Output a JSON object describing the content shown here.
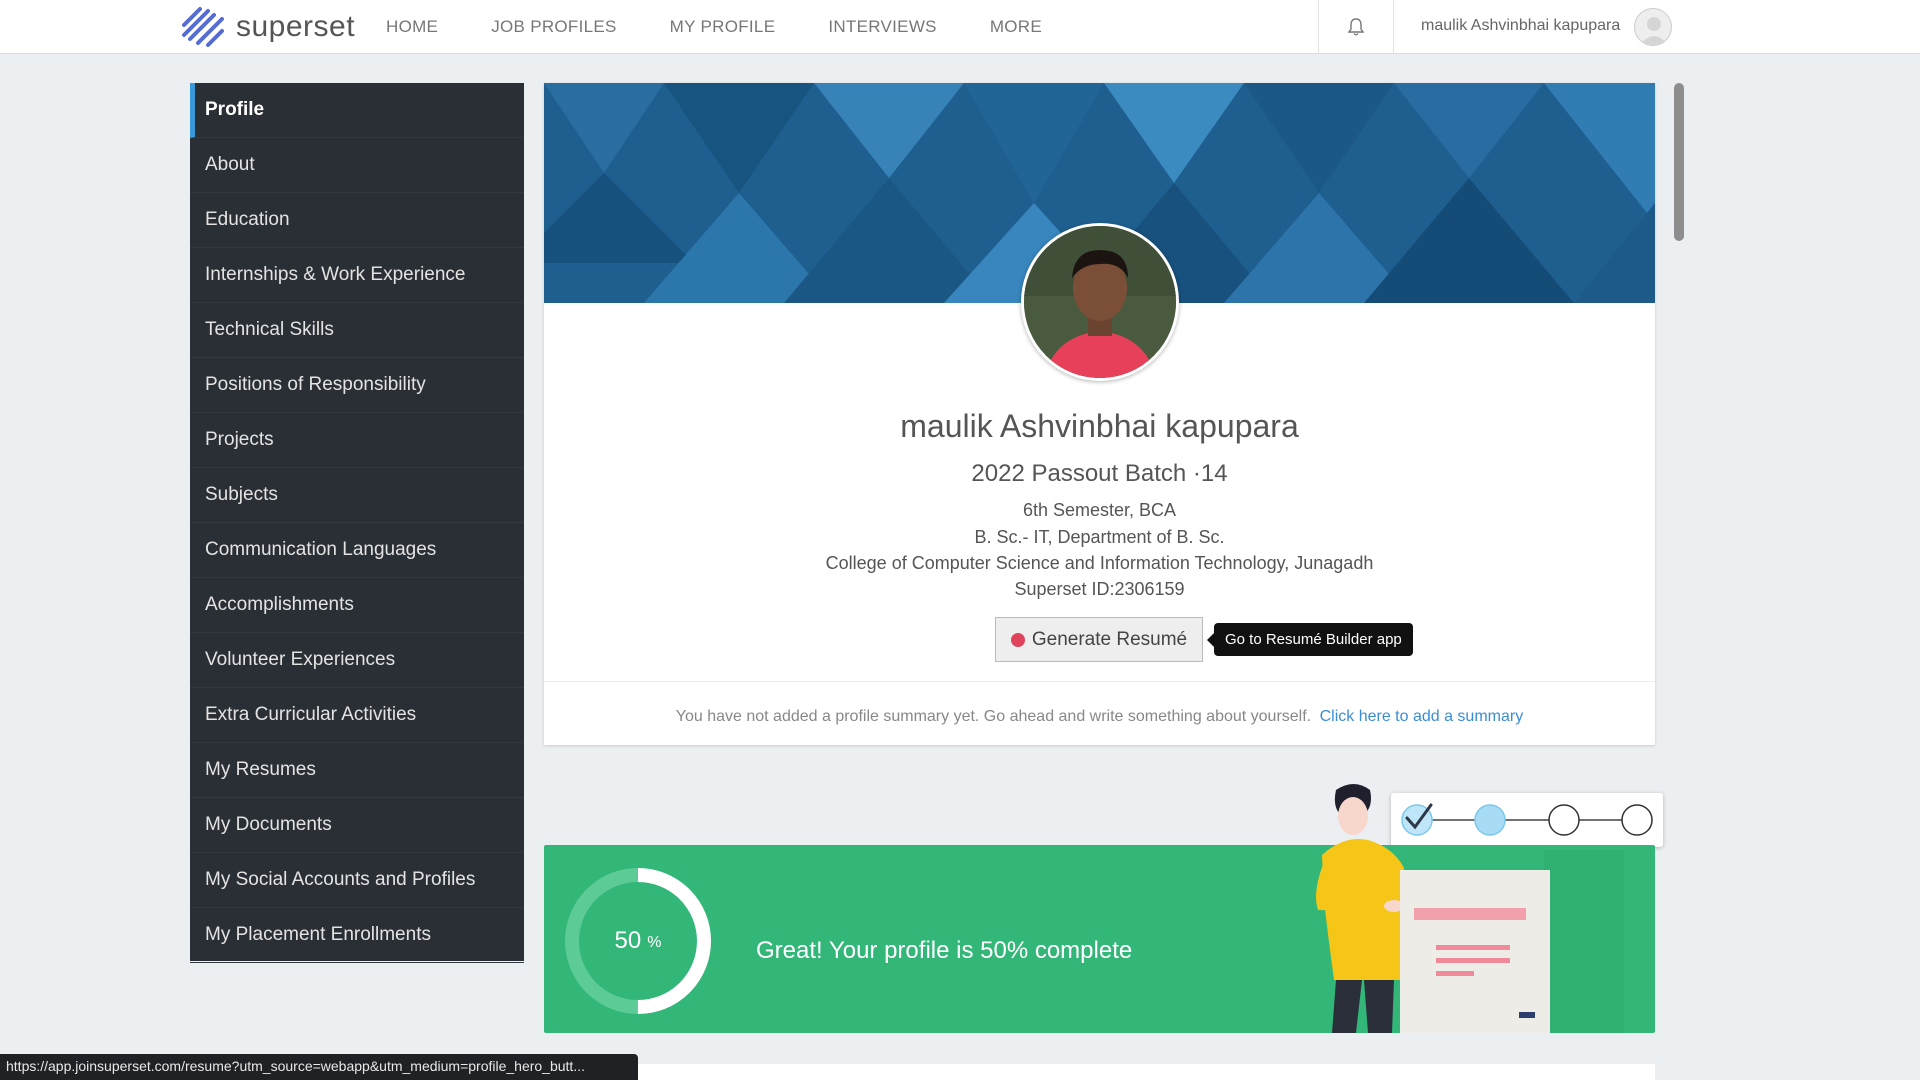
{
  "header": {
    "logo_text": "superset",
    "nav": [
      "HOME",
      "JOB PROFILES",
      "MY PROFILE",
      "INTERVIEWS",
      "MORE"
    ],
    "user_name": "maulik Ashvinbhai kapupara"
  },
  "sidebar": {
    "items": [
      {
        "label": "Profile"
      },
      {
        "label": "About"
      },
      {
        "label": "Education"
      },
      {
        "label": "Internships & Work Experience"
      },
      {
        "label": "Technical Skills"
      },
      {
        "label": "Positions of Responsibility"
      },
      {
        "label": "Projects"
      },
      {
        "label": "Subjects"
      },
      {
        "label": "Communication Languages"
      },
      {
        "label": "Accomplishments"
      },
      {
        "label": "Volunteer Experiences"
      },
      {
        "label": "Extra Curricular Activities"
      },
      {
        "label": "My Resumes"
      },
      {
        "label": "My Documents"
      },
      {
        "label": "My Social Accounts and Profiles"
      },
      {
        "label": "My Placement Enrollments"
      }
    ]
  },
  "profile": {
    "name": "maulik Ashvinbhai kapupara",
    "batch": "2022 Passout Batch ·14",
    "semester": "6th Semester, BCA",
    "department": "B. Sc.- IT, Department of B. Sc.",
    "college": "College of Computer Science and Information Technology, Junagadh",
    "superset_id": "Superset ID:2306159",
    "generate_button": "Generate Resumé",
    "tooltip": "Go to Resumé Builder app",
    "summary_text": "You have not added a profile summary yet. Go ahead and write something about yourself.",
    "summary_link": "Click here to add a summary"
  },
  "completion": {
    "percent_value": "50",
    "percent_sign": "%",
    "progress": 0.5,
    "message": "Great! Your profile is 50% complete",
    "steps_completed": 1,
    "steps_total": 4
  },
  "statusbar": {
    "url": "https://app.joinsuperset.com/resume?utm_source=webapp&utm_medium=profile_hero_butt..."
  },
  "colors": {
    "sidebar_bg": "#2a2e35",
    "accent": "#3a9ad9",
    "completion_green": "#33b779",
    "banner_blue": "#1e5c8c"
  }
}
